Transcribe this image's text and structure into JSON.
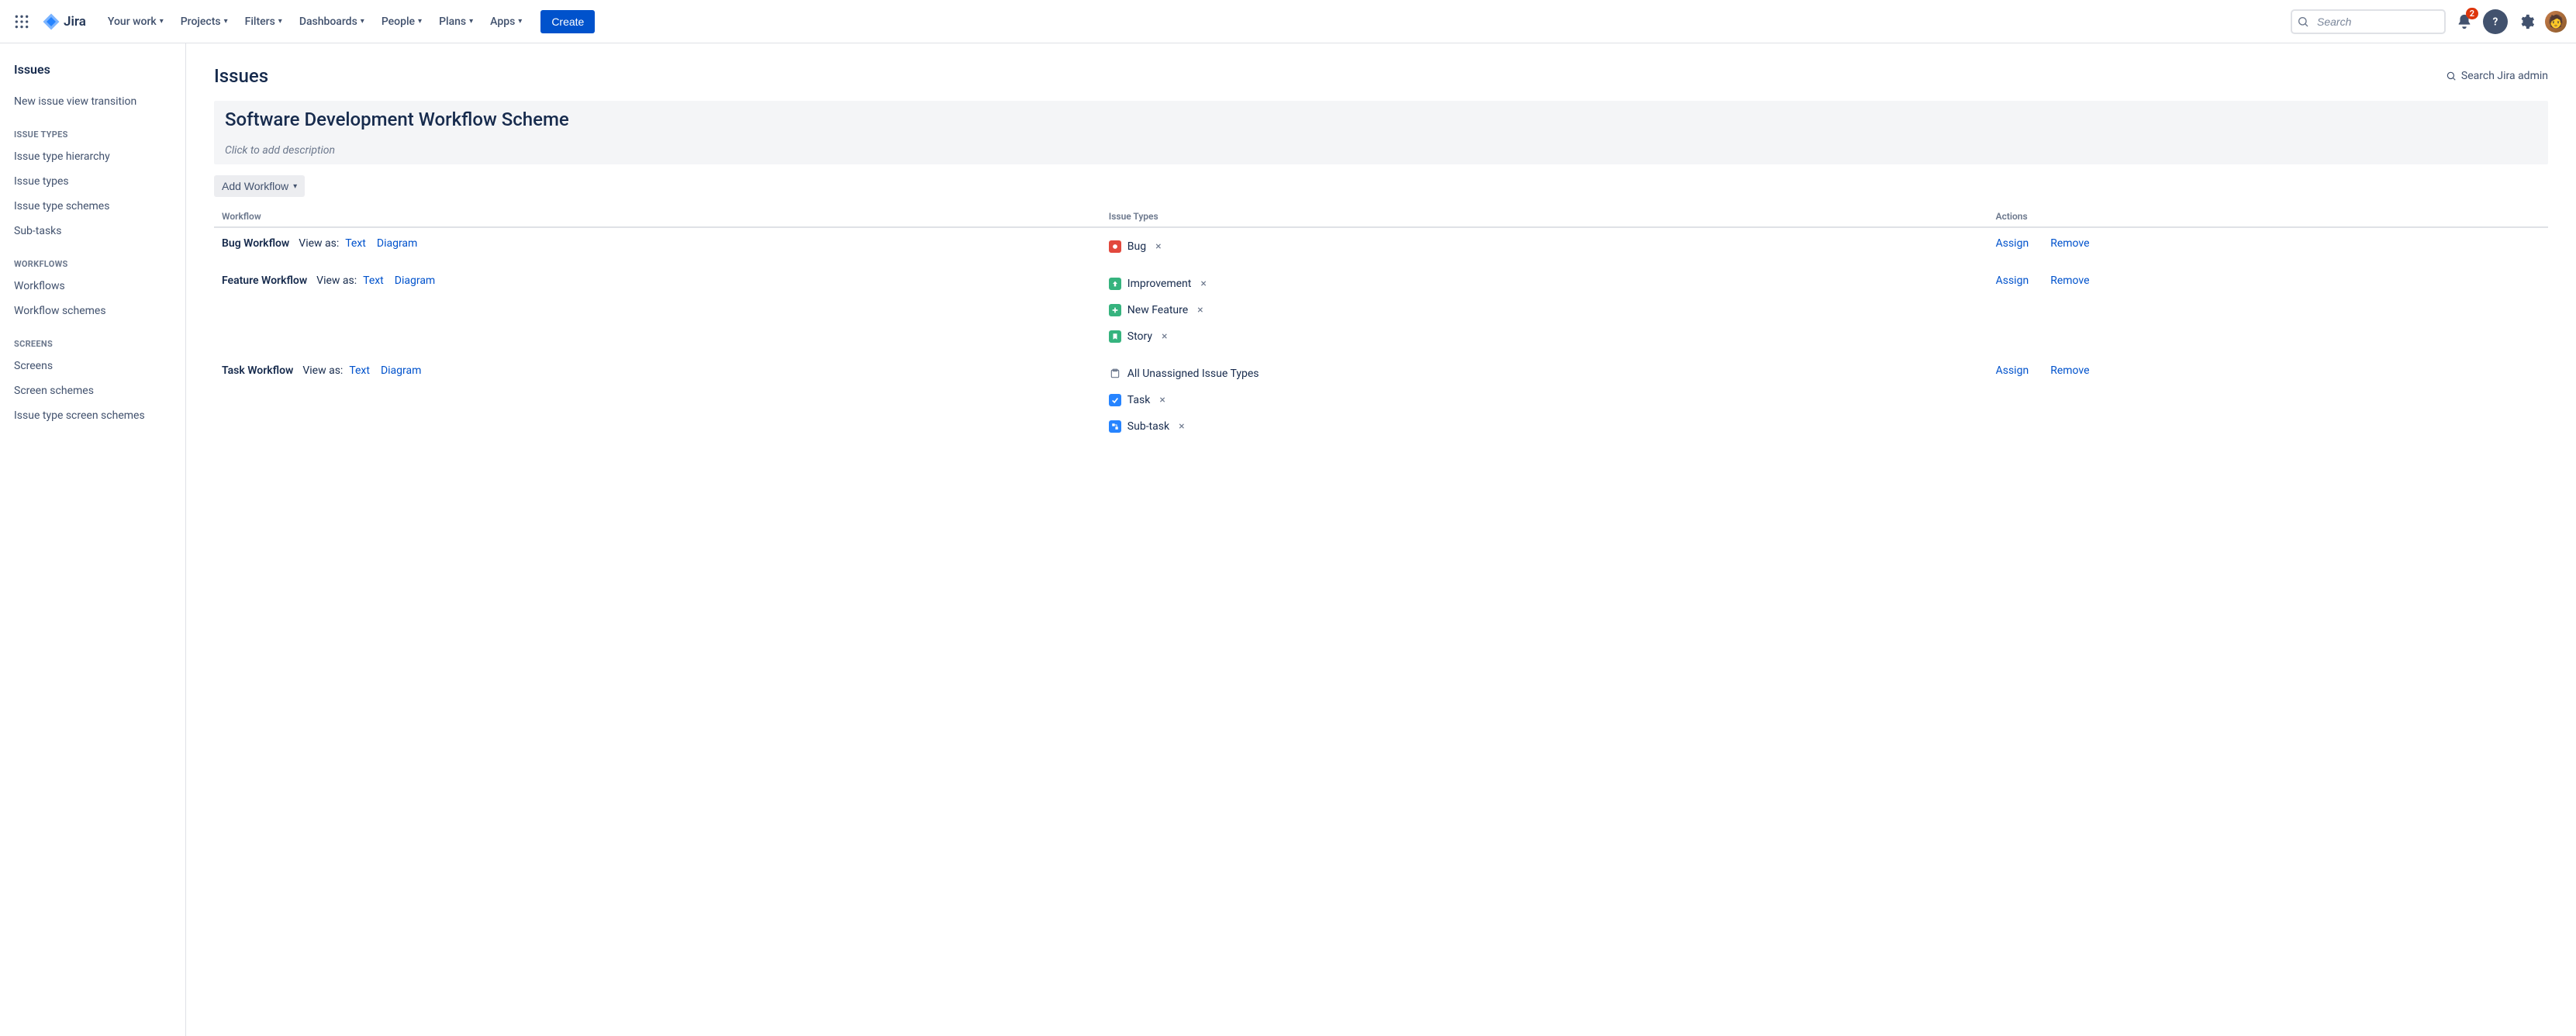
{
  "nav": {
    "product": "Jira",
    "items": [
      "Your work",
      "Projects",
      "Filters",
      "Dashboards",
      "People",
      "Plans",
      "Apps"
    ],
    "create": "Create",
    "search_placeholder": "Search",
    "notification_count": "2"
  },
  "sidebar": {
    "title": "Issues",
    "top_links": [
      "New issue view transition"
    ],
    "groups": [
      {
        "heading": "Issue types",
        "links": [
          "Issue type hierarchy",
          "Issue types",
          "Issue type schemes",
          "Sub-tasks"
        ]
      },
      {
        "heading": "Workflows",
        "links": [
          "Workflows",
          "Workflow schemes"
        ]
      },
      {
        "heading": "Screens",
        "links": [
          "Screens",
          "Screen schemes",
          "Issue type screen schemes"
        ]
      }
    ]
  },
  "main": {
    "page_title": "Issues",
    "admin_search": "Search Jira admin",
    "scheme_title": "Software Development Workflow Scheme",
    "scheme_desc_placeholder": "Click to add description",
    "add_workflow": "Add Workflow",
    "columns": {
      "workflow": "Workflow",
      "issue_types": "Issue Types",
      "actions": "Actions"
    },
    "viewas_label": "View as:",
    "viewas_text": "Text",
    "viewas_diagram": "Diagram",
    "action_assign": "Assign",
    "action_remove": "Remove",
    "rows": [
      {
        "name": "Bug Workflow",
        "issue_types": [
          {
            "label": "Bug",
            "color": "#e2483d",
            "icon": "bug"
          }
        ]
      },
      {
        "name": "Feature Workflow",
        "issue_types": [
          {
            "label": "Improvement",
            "color": "#36b37e",
            "icon": "arrow-up"
          },
          {
            "label": "New Feature",
            "color": "#36b37e",
            "icon": "plus"
          },
          {
            "label": "Story",
            "color": "#36b37e",
            "icon": "bookmark"
          }
        ]
      },
      {
        "name": "Task Workflow",
        "issue_types": [
          {
            "label": "All Unassigned Issue Types",
            "color": "transparent",
            "icon": "folder",
            "outline": true
          },
          {
            "label": "Task",
            "color": "#2684ff",
            "icon": "check"
          },
          {
            "label": "Sub-task",
            "color": "#2684ff",
            "icon": "subtask"
          }
        ]
      }
    ]
  }
}
